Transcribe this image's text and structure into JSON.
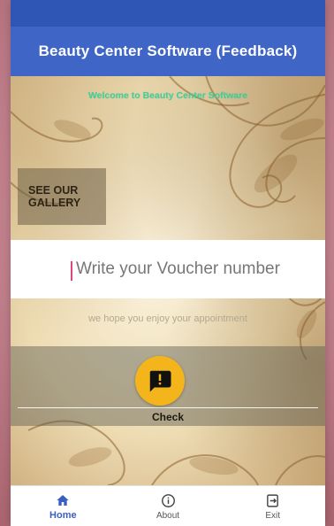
{
  "app_bar": {
    "title": "Beauty Center Software (Feedback)"
  },
  "main": {
    "welcome": "Welcome to Beauty Center Software",
    "gallery_button_label": "SEE OUR\nGALLERY",
    "voucher_placeholder": "Write your Voucher number",
    "voucher_value": "",
    "hope_text": "we hope you enjoy your appointment",
    "check_label": "Check"
  },
  "bottom_nav": {
    "items": [
      {
        "label": "Home",
        "icon": "home-icon",
        "active": true
      },
      {
        "label": "About",
        "icon": "info-icon",
        "active": false
      },
      {
        "label": "Exit",
        "icon": "exit-icon",
        "active": false
      }
    ]
  },
  "colors": {
    "app_bar": "#3f65c6",
    "status_bar": "#2f56b4",
    "welcome_text": "#3bd29a",
    "check_button": "#f3b51b",
    "nav_active": "#3a5fc4",
    "caret": "#e0457c"
  }
}
